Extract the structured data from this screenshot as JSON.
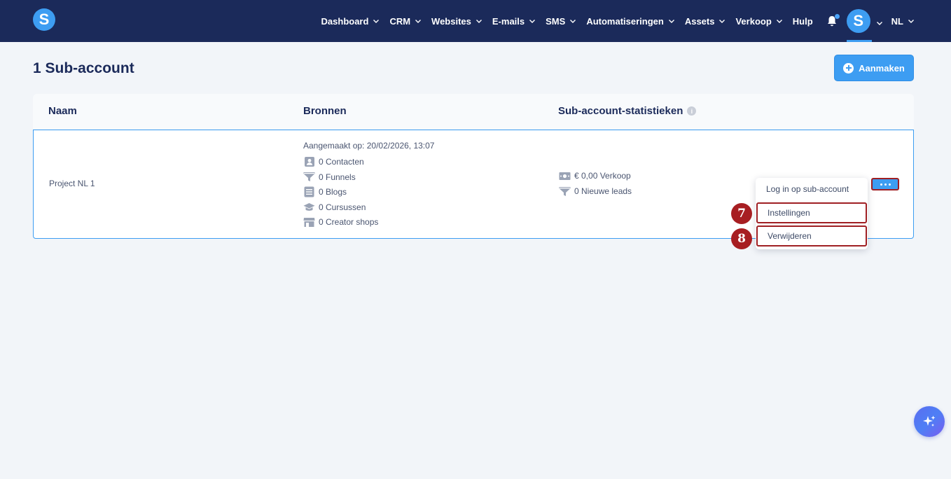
{
  "brand": {
    "logo_letter": "S"
  },
  "nav": {
    "items": [
      {
        "label": "Dashboard",
        "has_dropdown": true
      },
      {
        "label": "CRM",
        "has_dropdown": true
      },
      {
        "label": "Websites",
        "has_dropdown": true
      },
      {
        "label": "E-mails",
        "has_dropdown": true
      },
      {
        "label": "SMS",
        "has_dropdown": true
      },
      {
        "label": "Automatiseringen",
        "has_dropdown": true
      },
      {
        "label": "Assets",
        "has_dropdown": true
      },
      {
        "label": "Verkoop",
        "has_dropdown": true
      },
      {
        "label": "Hulp",
        "has_dropdown": false
      }
    ],
    "avatar_letter": "S",
    "language": "NL"
  },
  "header": {
    "title": "1 Sub-account",
    "create_label": "Aanmaken"
  },
  "table": {
    "columns": [
      "Naam",
      "Bronnen",
      "Sub-account-statistieken"
    ],
    "info_icon": "i",
    "row": {
      "name": "Project NL 1",
      "created": "Aangemaakt op: 20/02/2026, 13:07",
      "sources": [
        {
          "icon": "contact-icon",
          "text": "0 Contacten"
        },
        {
          "icon": "funnel-icon",
          "text": "0 Funnels"
        },
        {
          "icon": "blog-icon",
          "text": "0 Blogs"
        },
        {
          "icon": "graduation-cap-icon",
          "text": "0 Cursussen"
        },
        {
          "icon": "shop-icon",
          "text": "0 Creator shops"
        }
      ],
      "stats": [
        {
          "icon": "money-icon",
          "text": "€ 0,00 Verkoop"
        },
        {
          "icon": "funnel-icon",
          "text": "0 Nieuwe leads"
        }
      ]
    }
  },
  "dropdown": {
    "items": [
      {
        "label": "Log in op sub-account"
      },
      {
        "label": "Instellingen",
        "marker": "7"
      },
      {
        "label": "Verwijderen",
        "marker": "8"
      }
    ]
  },
  "colors": {
    "nav_bg": "#1b2a5a",
    "accent": "#3d9df2",
    "highlight": "#9f1f23",
    "page_bg": "#f2f5f9"
  }
}
